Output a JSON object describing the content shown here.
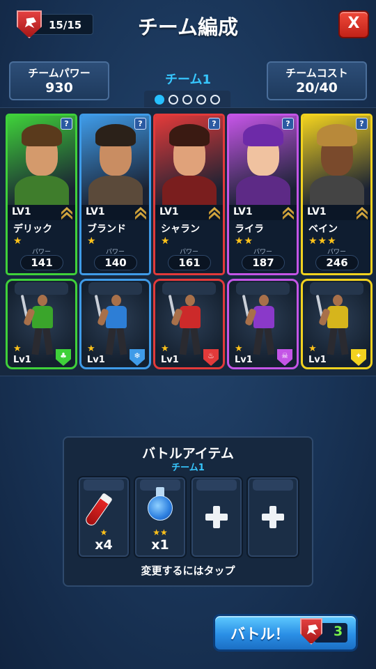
{
  "header": {
    "energy": "15/15",
    "title": "チーム編成",
    "close_label": "X"
  },
  "team_power": {
    "label": "チームパワー",
    "value": "930"
  },
  "team_name": "チーム1",
  "team_cost": {
    "label": "チームコスト",
    "value": "20/40"
  },
  "team_pages": {
    "current": 1,
    "total": 5
  },
  "heroes": [
    {
      "level": "LV1",
      "name": "デリック",
      "stars": "★",
      "power_label": "パワー",
      "power": "141",
      "color": "#3fd13a",
      "help": "?"
    },
    {
      "level": "LV1",
      "name": "ブランド",
      "stars": "★",
      "power_label": "パワー",
      "power": "140",
      "color": "#3f9be8",
      "help": "?"
    },
    {
      "level": "LV1",
      "name": "シャラン",
      "stars": "★",
      "power_label": "パワー",
      "power": "161",
      "color": "#e23a3a",
      "help": "?"
    },
    {
      "level": "LV1",
      "name": "ライラ",
      "stars": "★★",
      "power_label": "パワー",
      "power": "187",
      "color": "#c455e6",
      "help": "?"
    },
    {
      "level": "LV1",
      "name": "ベイン",
      "stars": "★★★",
      "power_label": "パワー",
      "power": "246",
      "color": "#f2d21f",
      "help": "?"
    }
  ],
  "troops": [
    {
      "level": "Lv1",
      "stars": "★",
      "color": "#3fd13a",
      "tunic": "#3aa52b",
      "element": "nature-icon",
      "element_glyph": "♣"
    },
    {
      "level": "Lv1",
      "stars": "★",
      "color": "#3f9be8",
      "tunic": "#2d7ed6",
      "element": "ice-icon",
      "element_glyph": "❄"
    },
    {
      "level": "Lv1",
      "stars": "★",
      "color": "#e23a3a",
      "tunic": "#cc2a2a",
      "element": "fire-icon",
      "element_glyph": "♨"
    },
    {
      "level": "Lv1",
      "stars": "★",
      "color": "#c455e6",
      "tunic": "#8a39c9",
      "element": "dark-icon",
      "element_glyph": "☠"
    },
    {
      "level": "Lv1",
      "stars": "★",
      "color": "#f2d21f",
      "tunic": "#d6b51c",
      "element": "holy-icon",
      "element_glyph": "✦"
    }
  ],
  "battle_items": {
    "title": "バトルアイテム",
    "team": "チーム1",
    "slots": [
      {
        "item": "red-potion",
        "stars": "★",
        "count": "x4"
      },
      {
        "item": "blue-potion",
        "stars": "★★",
        "count": "x1"
      },
      {
        "item": "empty",
        "stars": "",
        "count": ""
      },
      {
        "item": "empty",
        "stars": "",
        "count": ""
      }
    ],
    "hint": "変更するにはタップ"
  },
  "battle_button": {
    "label": "バトル！",
    "cost": "3"
  }
}
